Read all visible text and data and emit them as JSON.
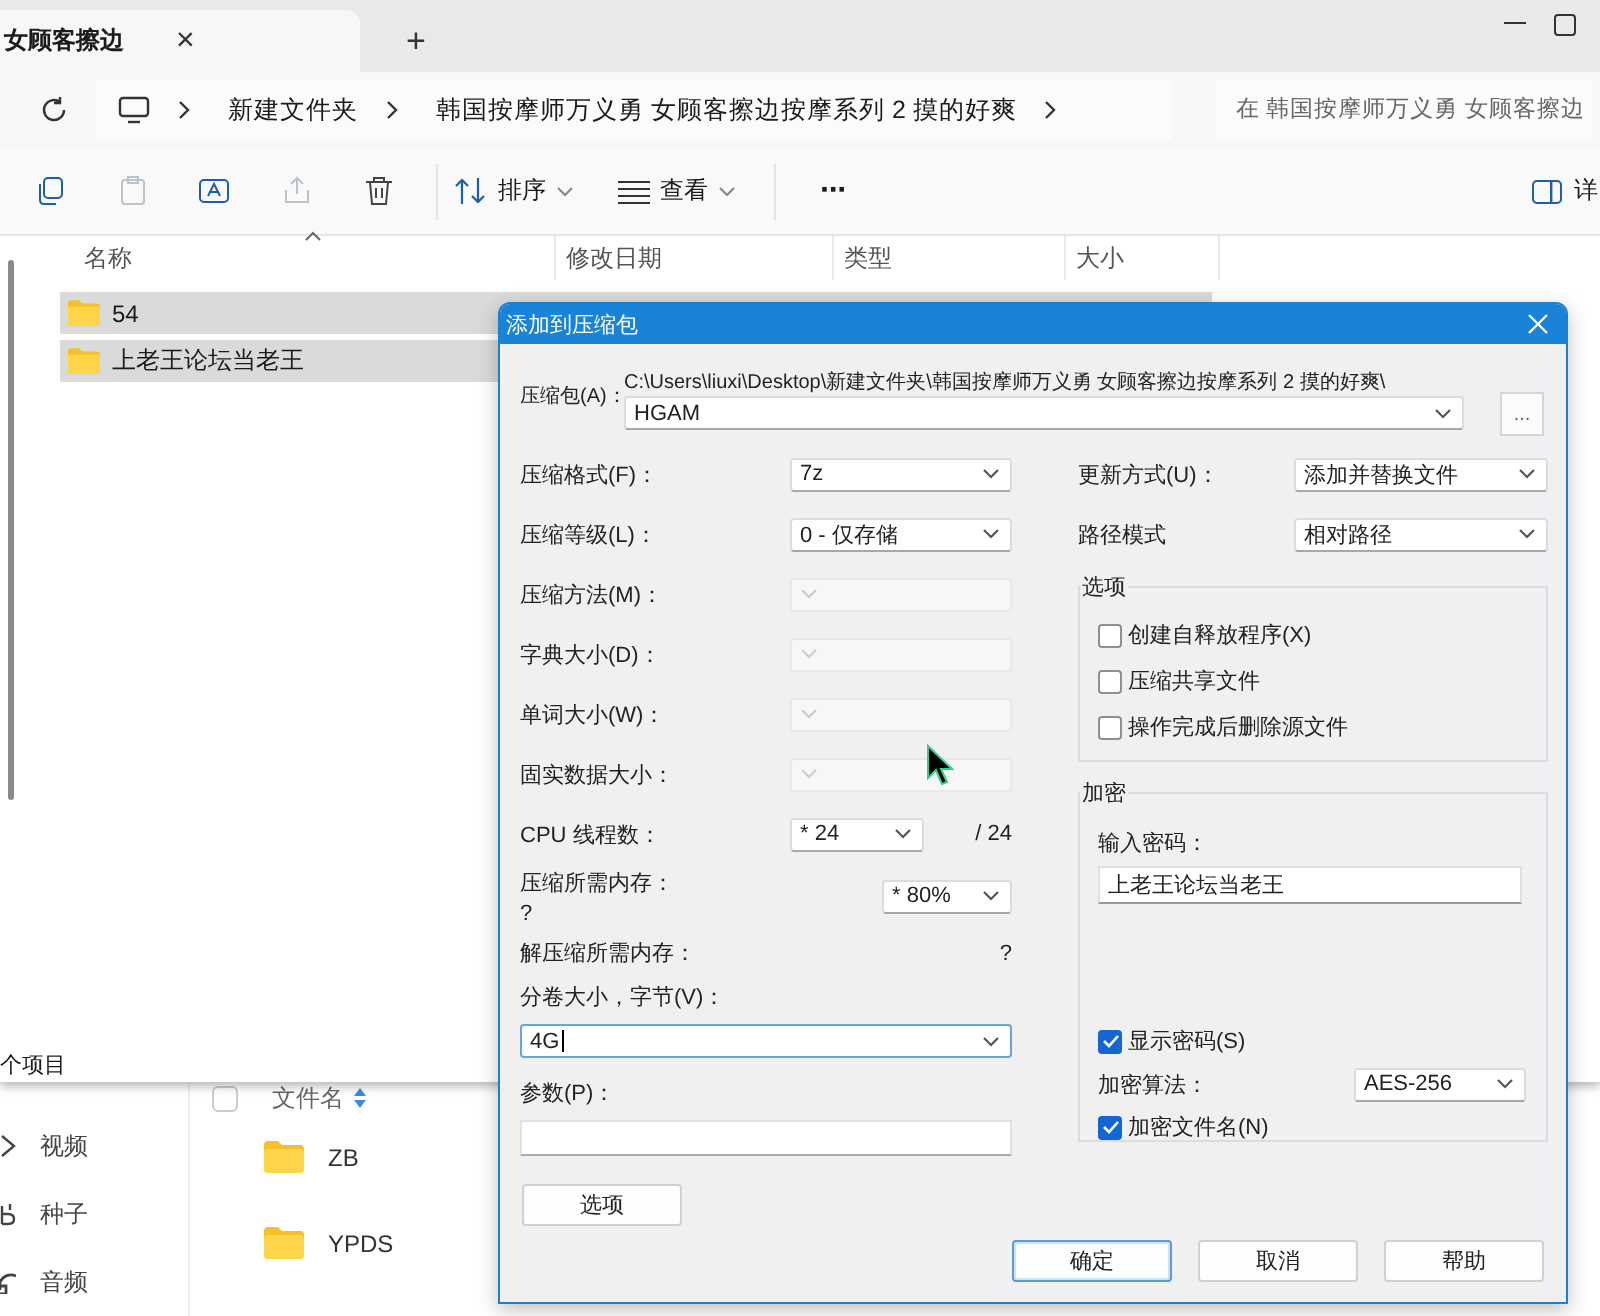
{
  "explorer": {
    "tab": {
      "title": "女顾客擦边",
      "close": "×"
    },
    "new_tab": "+",
    "breadcrumbs": [
      "新建文件夹",
      "韩国按摩师万义勇 女顾客擦边按摩系列 2 摸的好爽"
    ],
    "search": {
      "placeholder": "在 韩国按摩师万义勇 女顾客擦边"
    },
    "toolbar_buttons": [
      {
        "disabled": false
      },
      {
        "disabled": true
      },
      {
        "disabled": false
      },
      {
        "disabled": true
      },
      {
        "disabled": false
      }
    ],
    "sort": "排序",
    "view": "查看",
    "more": "···",
    "details": "详",
    "columns": [
      "名称",
      "修改日期",
      "类型",
      "大小"
    ],
    "rows": [
      {
        "name": "54",
        "selected": true
      },
      {
        "name": "上老王论坛当老王",
        "selected": true
      }
    ],
    "status": "个项目"
  },
  "background_app": {
    "sidebar": [
      "视频",
      "种子",
      "音频"
    ],
    "select_all": {
      "checked": false
    },
    "column": "文件名",
    "files": [
      "ZB",
      "YPDS"
    ]
  },
  "dialog": {
    "title": "添加到压缩包",
    "archive_label": "压缩包(A)：",
    "archive_path": "C:\\Users\\liuxi\\Desktop\\新建文件夹\\韩国按摩师万义勇 女顾客擦边按摩系列 2 摸的好爽\\",
    "archive_name": "HGAM",
    "browse": "...",
    "left_rows": [
      {
        "kind": "select",
        "label": "压缩格式(F)：",
        "value": "7z",
        "disabled": false
      },
      {
        "kind": "select",
        "label": "压缩等级(L)：",
        "value": "0 - 仅存储",
        "disabled": false
      },
      {
        "kind": "select",
        "label": "压缩方法(M)：",
        "disabled": true
      },
      {
        "kind": "select",
        "label": "字典大小(D)：",
        "disabled": true
      },
      {
        "kind": "select",
        "label": "单词大小(W)：",
        "disabled": true
      },
      {
        "kind": "select",
        "label": "固实数据大小：",
        "disabled": true
      },
      {
        "kind": "threads",
        "label": "CPU 线程数：",
        "value": "* 24",
        "total": "/ 24"
      },
      {
        "kind": "memory",
        "label": "压缩所需内存：",
        "note": "?",
        "value": "* 80%"
      },
      {
        "kind": "info",
        "label": "解压缩所需内存：",
        "note": "?"
      },
      {
        "kind": "combo",
        "label": "分卷大小，字节(V)：",
        "value": "4G",
        "focused": true
      },
      {
        "kind": "text",
        "label": "参数(P)："
      }
    ],
    "options_button": "选项",
    "update_mode": {
      "label": "更新方式(U)：",
      "value": "添加并替换文件"
    },
    "path_mode": {
      "label": "路径模式",
      "value": "相对路径"
    },
    "options_group": {
      "title": "选项",
      "checkboxes": [
        {
          "label": "创建自释放程序(X)",
          "checked": false
        },
        {
          "label": "压缩共享文件",
          "checked": false
        },
        {
          "label": "操作完成后删除源文件",
          "checked": false
        }
      ]
    },
    "encryption": {
      "title": "加密",
      "password_label": "输入密码：",
      "password": "上老王论坛当老王",
      "show_password": {
        "label": "显示密码(S)",
        "checked": true
      },
      "method_label": "加密算法：",
      "method": "AES-256",
      "encrypt_names": {
        "label": "加密文件名(N)",
        "checked": true
      }
    },
    "buttons": [
      {
        "label": "确定",
        "default": true
      },
      {
        "label": "取消",
        "default": false
      },
      {
        "label": "帮助",
        "default": false
      }
    ]
  }
}
